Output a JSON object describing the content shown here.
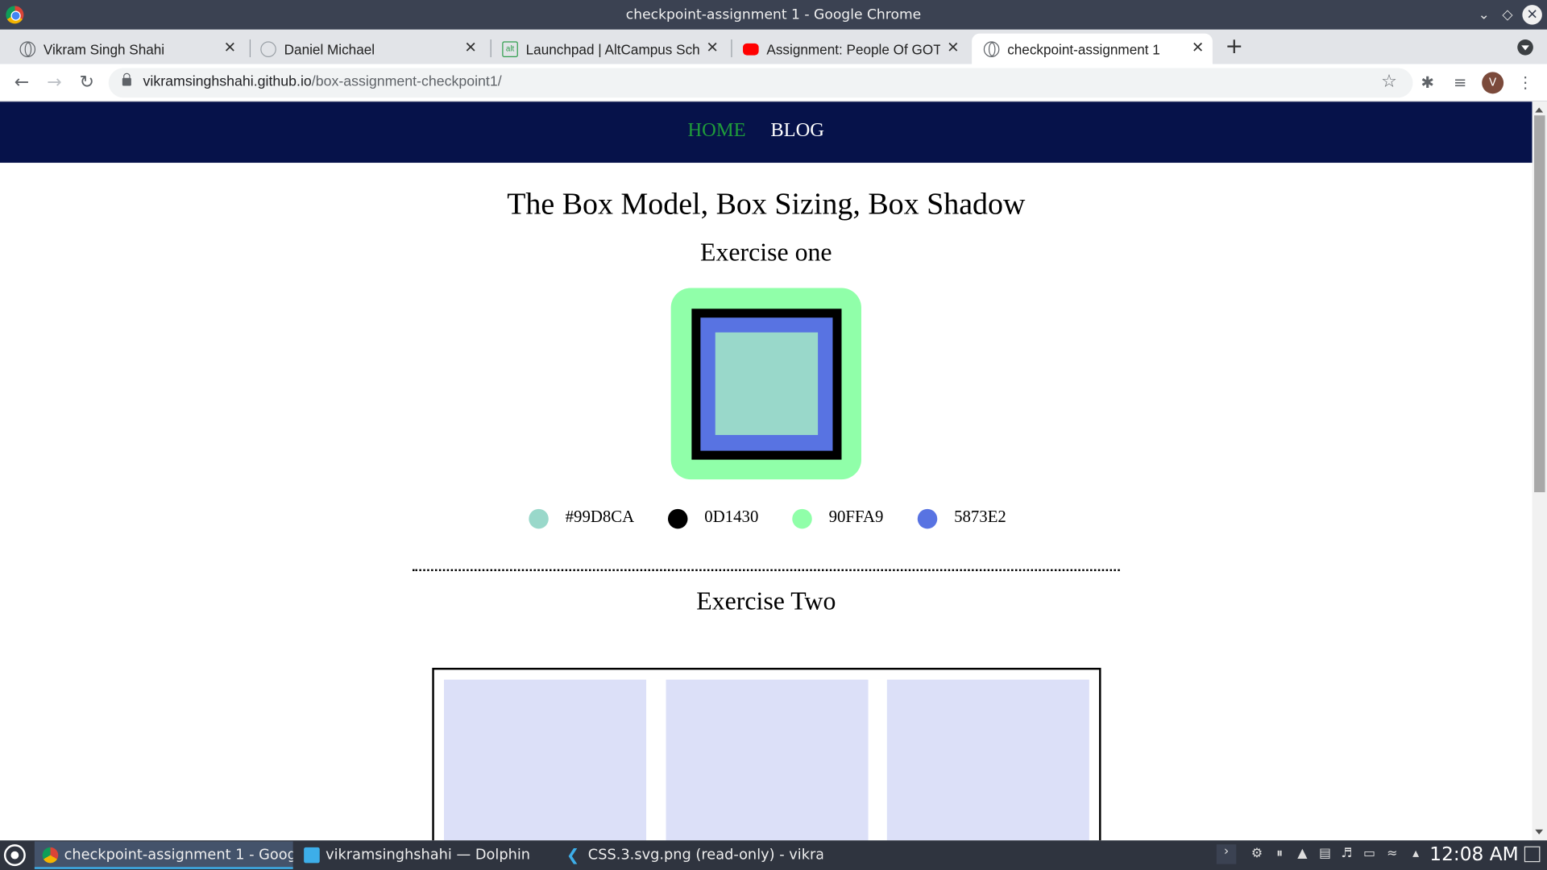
{
  "window": {
    "title": "checkpoint-assignment 1 - Google Chrome"
  },
  "tabs": [
    {
      "label": "Vikram Singh Shahi",
      "icon": "globe-icon"
    },
    {
      "label": "Daniel Michael",
      "icon": "globe-icon"
    },
    {
      "label": "Launchpad | AltCampus Sch",
      "icon": "altcampus-icon"
    },
    {
      "label": "Assignment: People Of GOT",
      "icon": "youtube-icon"
    },
    {
      "label": "checkpoint-assignment 1",
      "icon": "globe-icon",
      "active": true
    }
  ],
  "toolbar": {
    "url_host": "vikramsinghshahi.github.io",
    "url_path": "/box-assignment-checkpoint1/",
    "avatar_letter": "V"
  },
  "page": {
    "nav": {
      "home": "HOME",
      "blog": "BLOG"
    },
    "heading": "The Box Model, Box Sizing, Box Shadow",
    "exercise_one": {
      "title": "Exercise one",
      "swatches": [
        {
          "label": "#99D8CA",
          "color": "#99D8CA"
        },
        {
          "label": "0D1430",
          "color": "#000000"
        },
        {
          "label": "90FFA9",
          "color": "#90FFA9"
        },
        {
          "label": "5873E2",
          "color": "#5873E2"
        }
      ],
      "box_colors": {
        "outer": "#90FFA9",
        "border": "#000000",
        "middle": "#5873E2",
        "inner": "#99D8CA"
      }
    },
    "exercise_two": {
      "title": "Exercise Two",
      "card_color": "#DCE0F8"
    },
    "colors": {
      "nav_bg": "#06124A",
      "nav_home": "#1F9C3A",
      "nav_blog": "#FFFFFF"
    }
  },
  "taskbar": {
    "tasks": [
      {
        "label": "checkpoint-assignment 1 - Googl...",
        "icon": "chrome-icon",
        "active": true
      },
      {
        "label": "vikramsinghshahi — Dolphin",
        "icon": "folder-icon"
      },
      {
        "label": "CSS.3.svg.png (read-only) - vikram...",
        "icon": "vscode-icon"
      }
    ],
    "clock": "12:08 AM"
  }
}
